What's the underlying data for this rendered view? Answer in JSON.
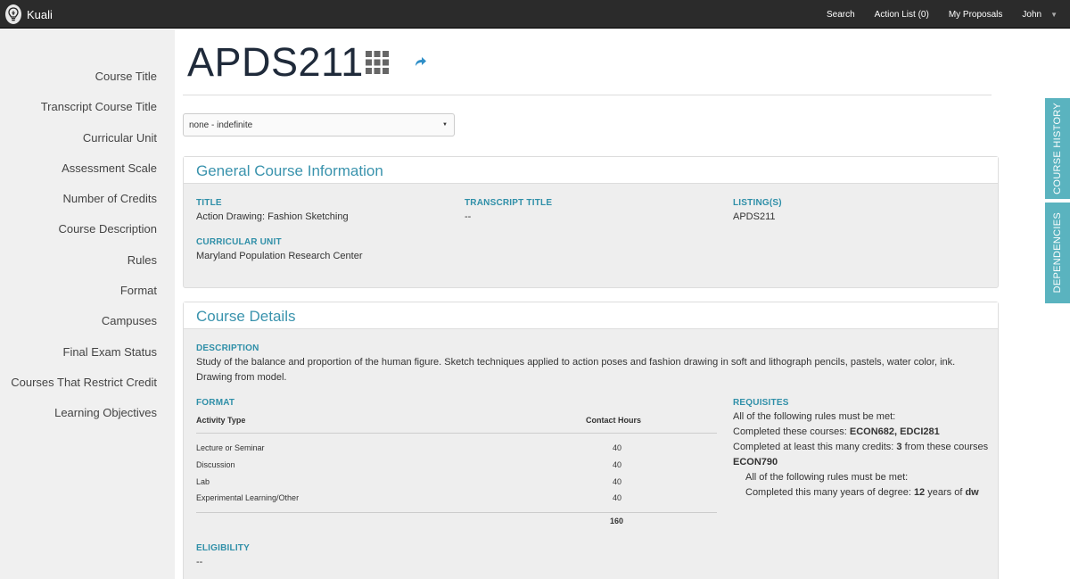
{
  "topbar": {
    "brand": "Kuali",
    "nav": [
      "Search",
      "Action List (0)",
      "My Proposals",
      "John"
    ]
  },
  "sidebar": {
    "items": [
      "Course Title",
      "Transcript Course Title",
      "Curricular Unit",
      "Assessment Scale",
      "Number of Credits",
      "Course Description",
      "Rules",
      "Format",
      "Campuses",
      "Final Exam Status",
      "Courses That Restrict Credit",
      "Learning Objectives"
    ]
  },
  "header": {
    "course_code": "APDS211",
    "grid_icon": "grid-icon",
    "share_icon": "share-icon"
  },
  "version_select": {
    "value": "none - indefinite"
  },
  "general": {
    "heading": "General Course Information",
    "title_label": "TITLE",
    "title_value": "Action Drawing: Fashion Sketching",
    "transcript_label": "TRANSCRIPT TITLE",
    "transcript_value": "--",
    "listing_label": "LISTING(S)",
    "listing_value": "APDS211",
    "unit_label": "CURRICULAR UNIT",
    "unit_value": "Maryland Population Research Center"
  },
  "details": {
    "heading": "Course Details",
    "description_label": "DESCRIPTION",
    "description": "Study of the balance and proportion of the human figure. Sketch techniques applied to action poses and fashion drawing in soft and lithograph pencils, pastels, water color, ink. Drawing from model.",
    "format_label": "FORMAT",
    "format_columns": [
      "Activity Type",
      "Contact Hours"
    ],
    "format_rows": [
      {
        "type": "Lecture or Seminar",
        "hours": "40"
      },
      {
        "type": "Discussion",
        "hours": "40"
      },
      {
        "type": "Lab",
        "hours": "40"
      },
      {
        "type": "Experimental Learning/Other",
        "hours": "40"
      }
    ],
    "format_total": "160",
    "requisites_label": "REQUISITES",
    "req_all": "All of the following rules must be met:",
    "req_completed_prefix": "Completed these courses: ",
    "req_completed_courses": "ECON682, EDCI281",
    "req_credits_prefix": "Completed at least this many credits: ",
    "req_credits_value": "3",
    "req_credits_mid": " from these courses ",
    "req_credits_course": "ECON790",
    "req_nested_all": "All of the following rules must be met:",
    "req_years_prefix": "Completed this many years of degree: ",
    "req_years_value": "12",
    "req_years_mid": " years of ",
    "req_years_degree": "dw",
    "eligibility_label": "ELIGIBILITY",
    "eligibility_value": "--"
  },
  "side_tabs": [
    "COURSE HISTORY",
    "DEPENDENCIES"
  ],
  "colors": {
    "accent": "#2f8fa8",
    "topbar": "#2b2b2b",
    "side_tab": "#5ab3bf"
  }
}
